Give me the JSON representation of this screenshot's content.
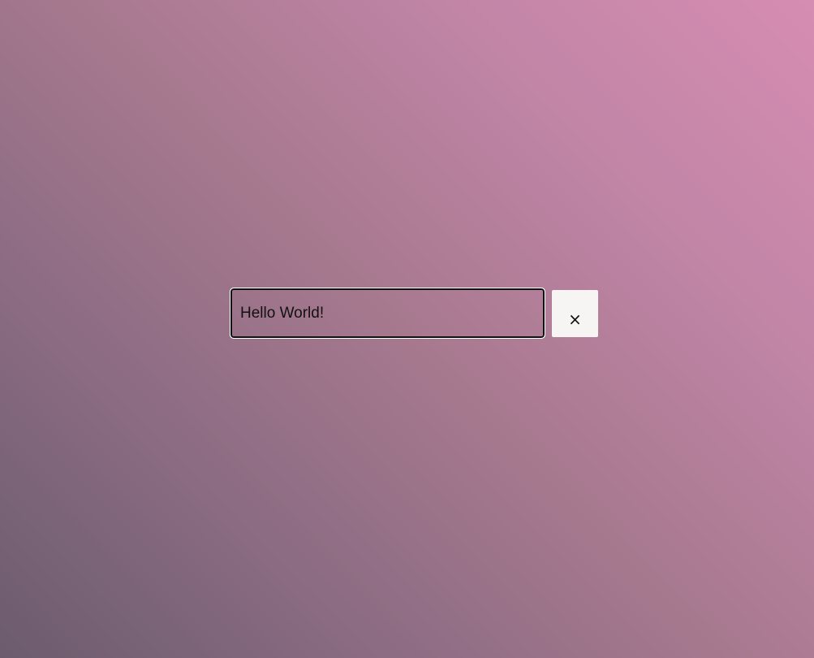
{
  "text_field": {
    "value": "Hello World!",
    "placeholder": ""
  },
  "clear_button": {
    "icon": "close-icon",
    "glyph": "×"
  },
  "colors": {
    "background_start": "#6b5c6c",
    "background_end": "#d68db2",
    "button_bg": "#f7f4f4",
    "text": "#111111"
  }
}
